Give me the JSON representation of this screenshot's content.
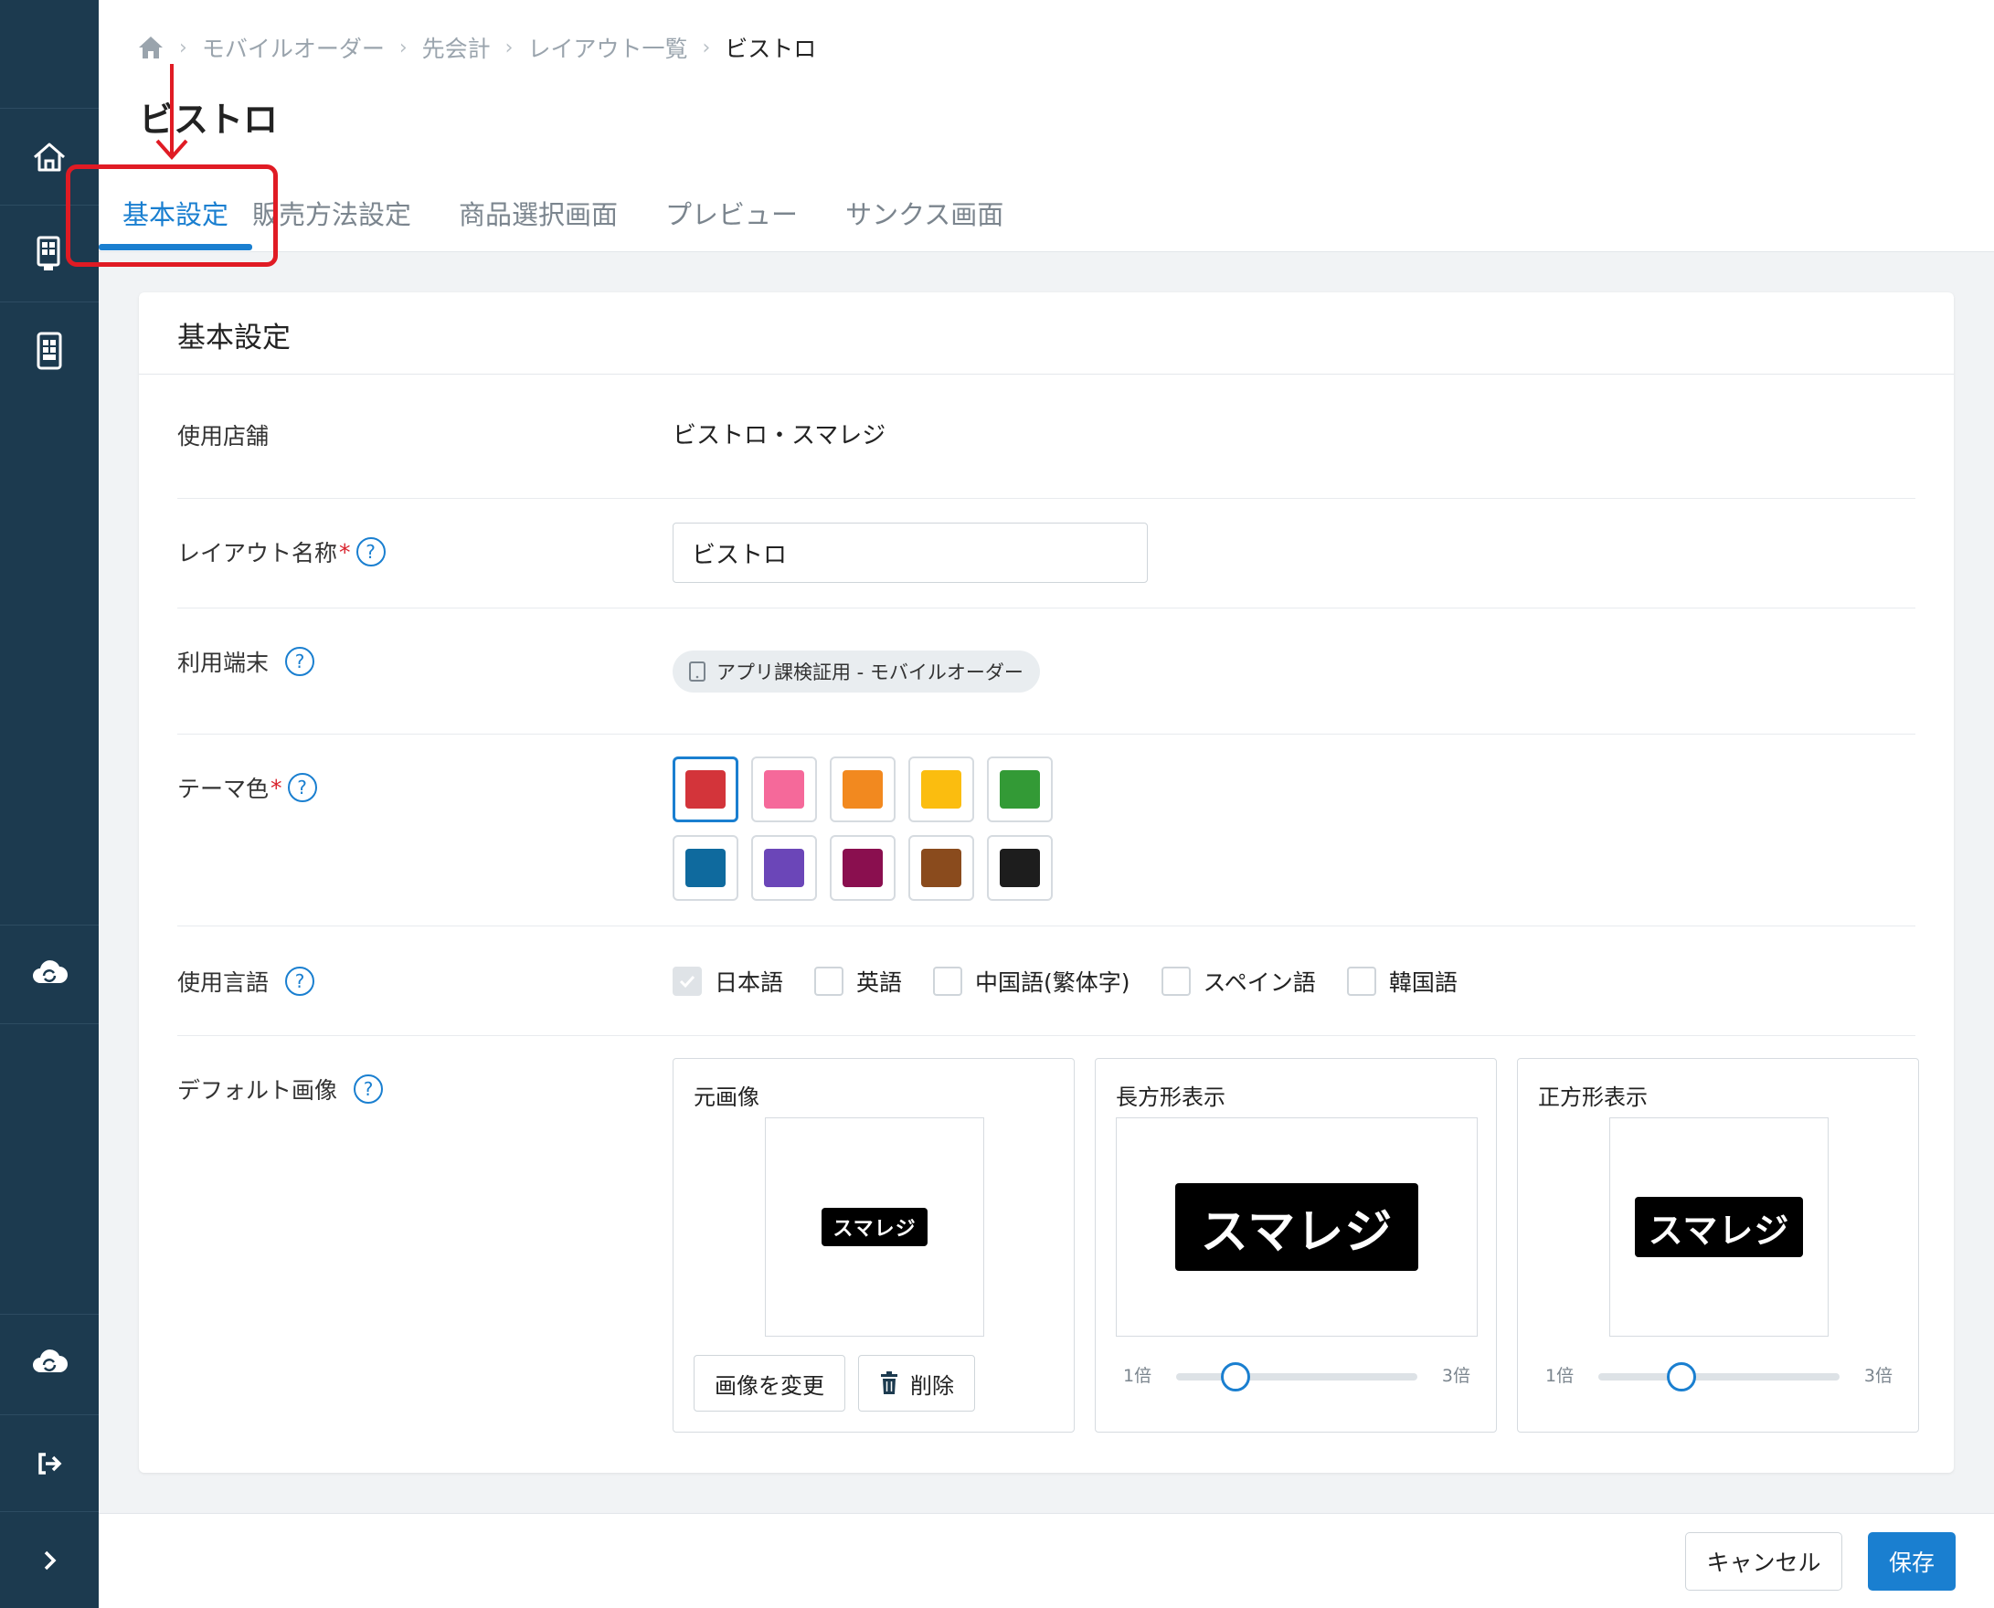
{
  "breadcrumb": {
    "items": [
      "モバイルオーダー",
      "先会計",
      "レイアウト一覧"
    ],
    "current": "ビストロ"
  },
  "page": {
    "title": "ビストロ"
  },
  "tabs": [
    {
      "label": "基本設定",
      "active": true
    },
    {
      "label": "販売方法設定",
      "active": false
    },
    {
      "label": "商品選択画面",
      "active": false
    },
    {
      "label": "プレビュー",
      "active": false
    },
    {
      "label": "サンクス画面",
      "active": false
    }
  ],
  "card": {
    "title": "基本設定"
  },
  "fields": {
    "store": {
      "label": "使用店舗",
      "value": "ビストロ・スマレジ"
    },
    "layout_name": {
      "label": "レイアウト名称",
      "required_mark": "*",
      "value": "ビストロ"
    },
    "device": {
      "label": "利用端末",
      "chip": "アプリ課検証用 - モバイルオーダー"
    },
    "theme": {
      "label": "テーマ色",
      "required_mark": "*",
      "colors": [
        "#d3343a",
        "#f5699a",
        "#f2891f",
        "#fbbd0f",
        "#339a36",
        "#0f6a9e",
        "#6b46b8",
        "#8a0f4f",
        "#8a4b1d",
        "#1d1d1d"
      ],
      "selected_index": 0
    },
    "language": {
      "label": "使用言語",
      "options": [
        {
          "label": "日本語",
          "checked": true
        },
        {
          "label": "英語",
          "checked": false
        },
        {
          "label": "中国語(繁体字)",
          "checked": false
        },
        {
          "label": "スペイン語",
          "checked": false
        },
        {
          "label": "韓国語",
          "checked": false
        }
      ]
    },
    "default_image": {
      "label": "デフォルト画像",
      "logo_text": "スマレジ",
      "original": {
        "title": "元画像",
        "change_button": "画像を変更",
        "delete_button": "削除"
      },
      "rectangle": {
        "title": "長方形表示",
        "min": "1倍",
        "max": "3倍",
        "zoom_fraction": 0.2
      },
      "square": {
        "title": "正方形表示",
        "min": "1倍",
        "max": "3倍",
        "zoom_fraction": 0.3
      }
    },
    "help_symbol": "?"
  },
  "footer": {
    "cancel_label": "キャンセル",
    "save_label": "保存"
  },
  "colors": {
    "sidebar": "#1c3a4f",
    "accent": "#1a7fd0",
    "annotation": "#e01b24",
    "required": "#d9232d"
  }
}
